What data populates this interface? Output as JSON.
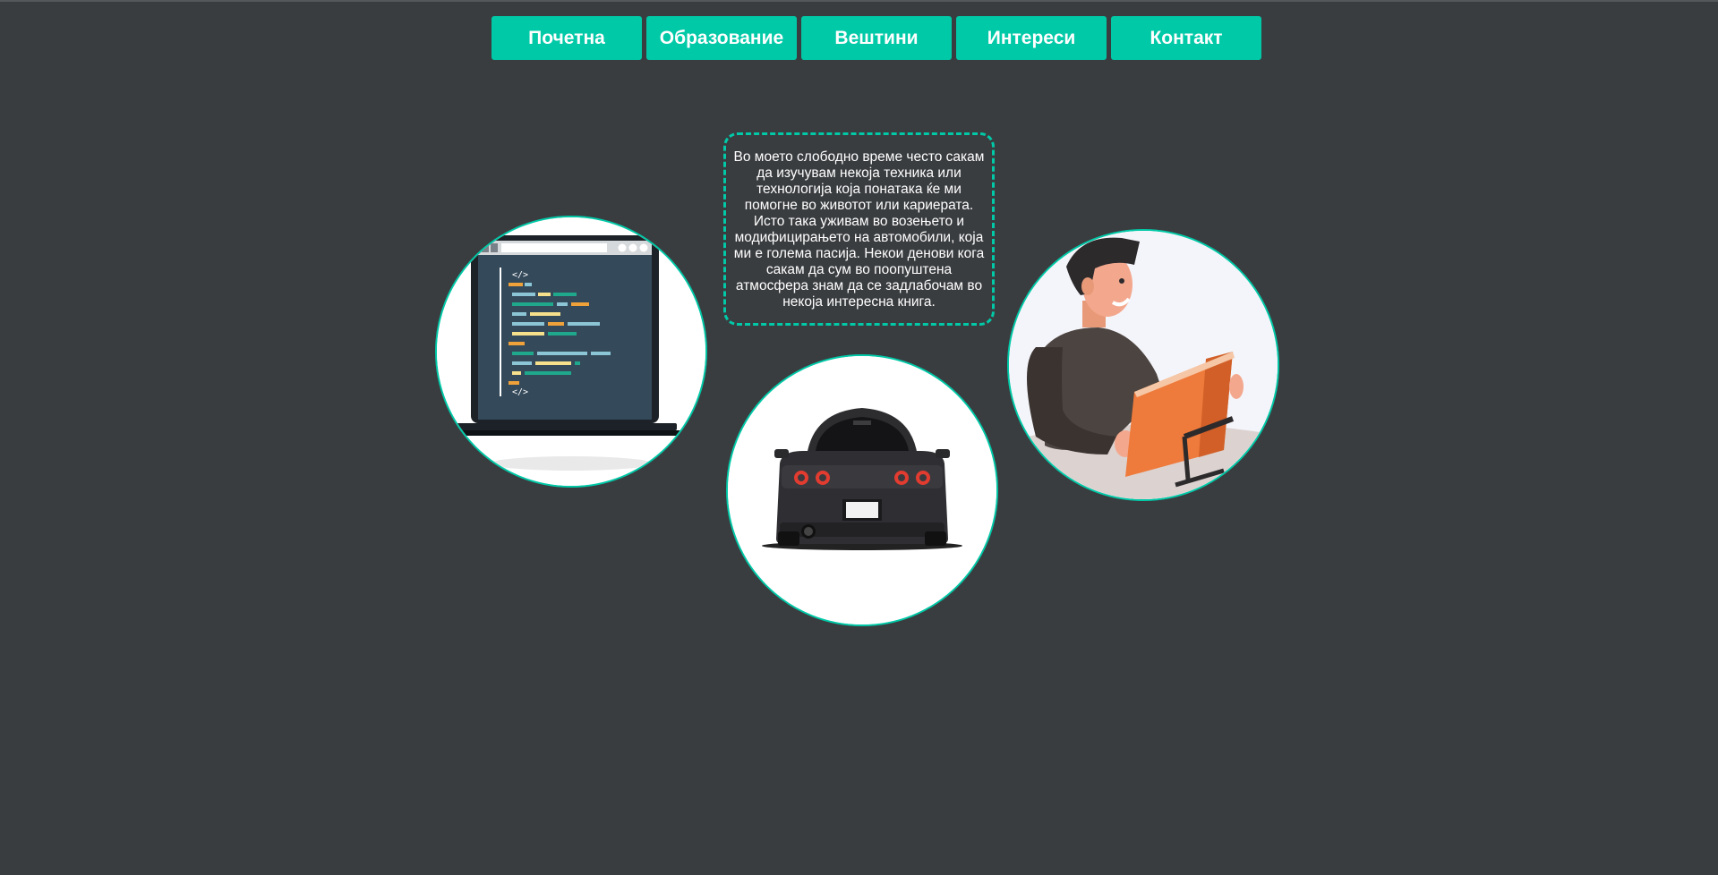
{
  "nav": {
    "items": [
      {
        "label": "Почетна"
      },
      {
        "label": "Образование"
      },
      {
        "label": "Вештини"
      },
      {
        "label": "Интереси"
      },
      {
        "label": "Контакт"
      }
    ]
  },
  "interests": {
    "text": "Во моето слободно време често сакам да изучувам некоја техника или технологија која понатака ќе ми помогне во животот или кариерата. Исто така уживам во возењето и модифицирањето на автомобили, која ми е голема пасија. Некои денови кога сакам да сум во поопуштена атмосфера знам да се задлабочам во некоја интересна книга."
  },
  "images": {
    "laptop": {
      "icon": "laptop-code-icon"
    },
    "car": {
      "icon": "car-rear-icon"
    },
    "reader": {
      "icon": "person-reading-book-icon"
    }
  },
  "colors": {
    "accent": "#00c9a7",
    "background": "#3a3d40"
  }
}
